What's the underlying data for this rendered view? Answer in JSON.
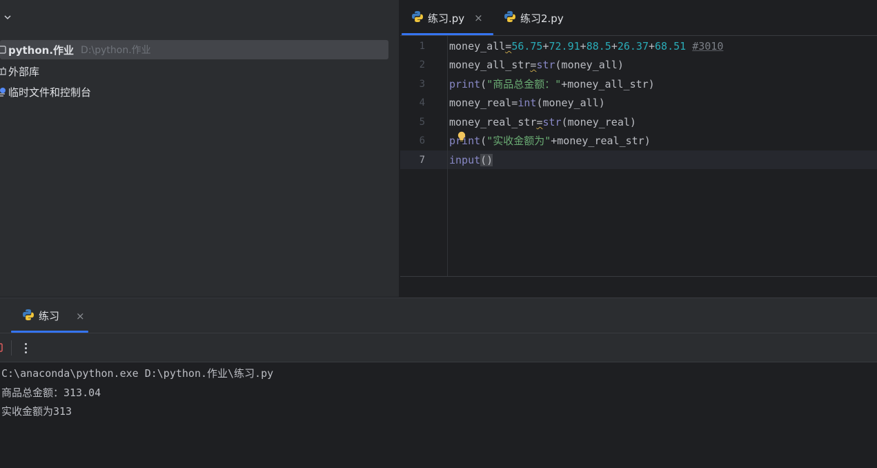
{
  "project": {
    "tree": [
      {
        "label": "python.作业",
        "path": "D:\\python.作业",
        "selected": true,
        "icon": "folder-icon"
      },
      {
        "label": "外部库",
        "path": "",
        "selected": false,
        "icon": "library-icon"
      },
      {
        "label": "临时文件和控制台",
        "path": "",
        "selected": false,
        "icon": "scratches-icon"
      }
    ]
  },
  "editor": {
    "tabs": [
      {
        "label": "练习.py",
        "active": true,
        "close": "×",
        "icon": "python-file-icon"
      },
      {
        "label": "练习2.py",
        "active": false,
        "icon": "python-file-icon"
      }
    ],
    "line_numbers": [
      "1",
      "2",
      "3",
      "4",
      "5",
      "6",
      "7"
    ],
    "current_line": 7,
    "lines": [
      {
        "p0": "money_all",
        "op": "=",
        "n1": "56.75",
        "s1": "+",
        "n2": "72.91",
        "s2": "+",
        "n3": "88.5",
        "s3": "+",
        "n4": "26.37",
        "s4": "+",
        "n5": "68.51",
        "sp": " ",
        "comment": "#3010"
      },
      {
        "p0": "money_all_str",
        "op": "=",
        "fn": "str",
        "rest": "(money_all)"
      },
      {
        "fn": "print",
        "p1": "(",
        "str": "\"商品总金额：\"",
        "rest": "+money_all_str)"
      },
      {
        "p0": "money_real=",
        "fn": "int",
        "rest": "(money_all)"
      },
      {
        "p0": "money_real_str",
        "op": "=",
        "fn": "str",
        "rest": "(money_real)"
      },
      {
        "fn": "print",
        "p1": "(",
        "str": "\"实收金额为\"",
        "rest": "+money_real_str)"
      },
      {
        "fn": "input",
        "paren": "()"
      }
    ]
  },
  "run": {
    "tab_label": "练习",
    "tab_close": "×",
    "console": [
      "C:\\anaconda\\python.exe D:\\python.作业\\练习.py",
      "商品总金额：313.04",
      "实收金额为313"
    ]
  },
  "colors": {
    "accent": "#3574f0",
    "number": "#2aacb8",
    "builtin": "#8888c6",
    "string": "#6aab73",
    "comment": "#7a7e85",
    "stop": "#db5c5c"
  }
}
